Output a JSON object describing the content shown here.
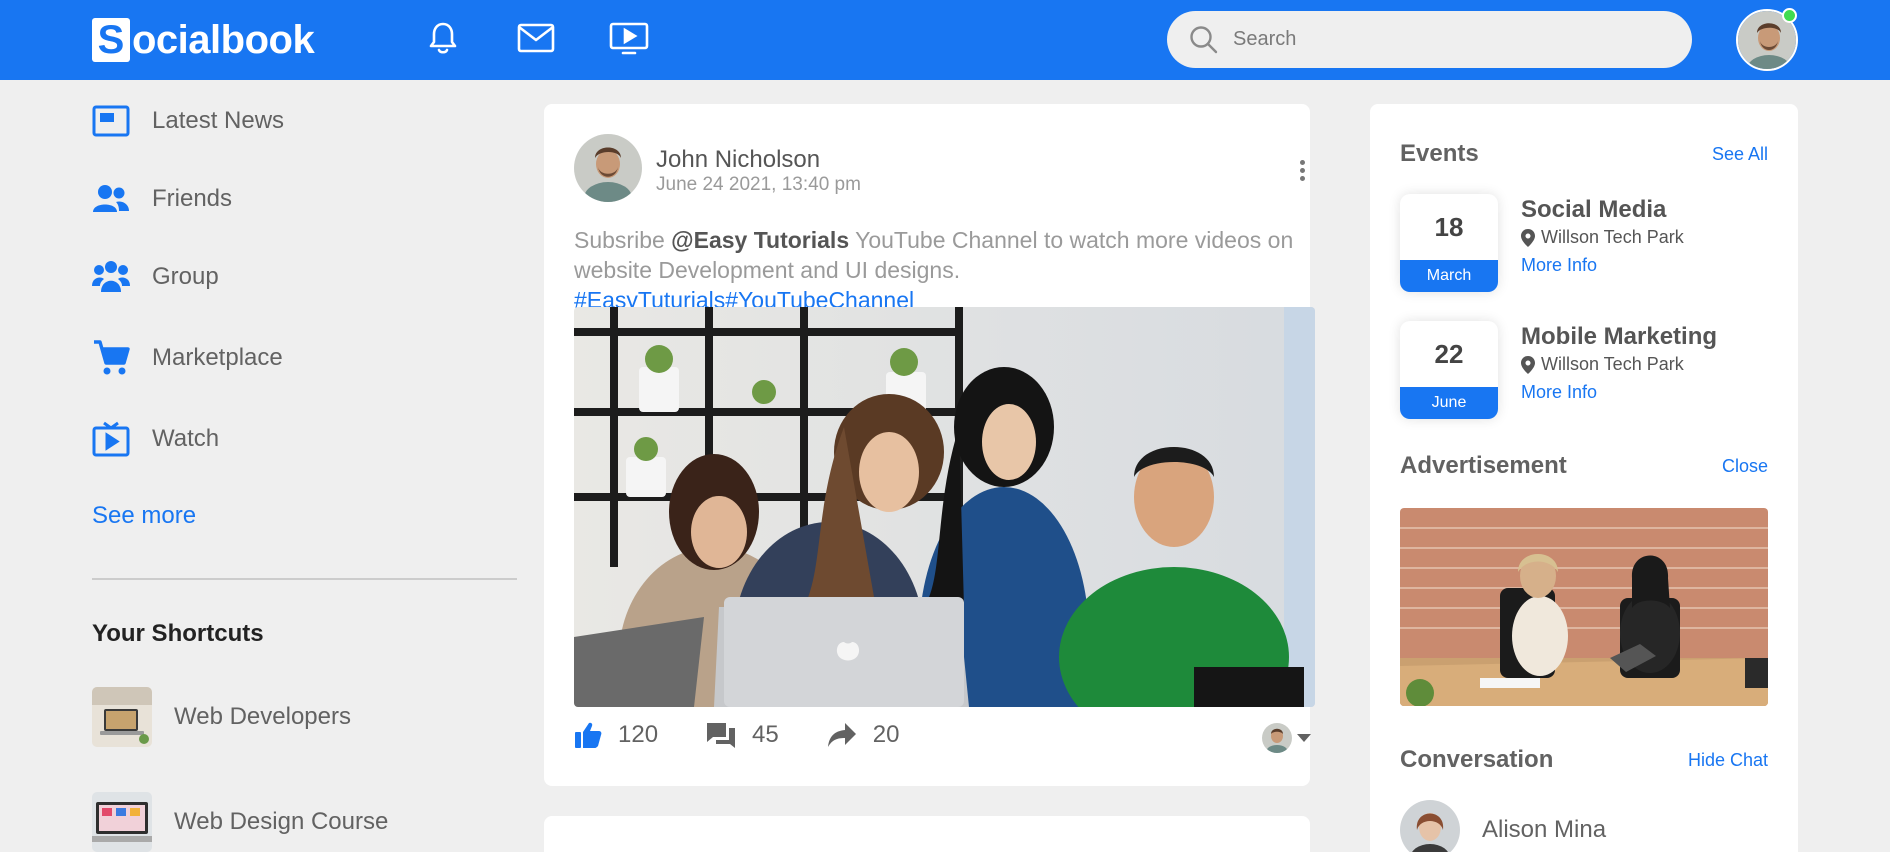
{
  "navbar": {
    "logo_letter": "S",
    "logo_text": "ocialbook",
    "search_placeholder": "Search",
    "icons": [
      "bell-icon",
      "mail-icon",
      "video-icon",
      "search-icon"
    ],
    "accent_color": "#1876f2",
    "online_color": "#41db51"
  },
  "sidebar": {
    "items": [
      {
        "label": "Latest News",
        "icon": "news-icon"
      },
      {
        "label": "Friends",
        "icon": "friends-icon"
      },
      {
        "label": "Group",
        "icon": "group-icon"
      },
      {
        "label": "Marketplace",
        "icon": "cart-icon"
      },
      {
        "label": "Watch",
        "icon": "watch-icon"
      }
    ],
    "see_more": "See more",
    "shortcuts_title": "Your Shortcuts",
    "shortcuts": [
      {
        "label": "Web Developers"
      },
      {
        "label": "Web Design Course"
      }
    ]
  },
  "post": {
    "author": "John Nicholson",
    "date": "June 24 2021, 13:40 pm",
    "text_before": "Subsribe ",
    "mention": "@Easy Tutorials",
    "text_after": " YouTube Channel to watch more videos on website Development and UI designs. ",
    "tags": "#EasyTuturials#YouTubeChannel",
    "likes": "120",
    "comments": "45",
    "shares": "20"
  },
  "right_sidebar": {
    "events_title": "Events",
    "events_link": "See All",
    "events": [
      {
        "day": "18",
        "month": "March",
        "title": "Social Media",
        "location": "Willson Tech Park",
        "more": "More Info"
      },
      {
        "day": "22",
        "month": "June",
        "title": "Mobile Marketing",
        "location": "Willson Tech Park",
        "more": "More Info"
      }
    ],
    "ad_title": "Advertisement",
    "ad_link": "Close",
    "conversation_title": "Conversation",
    "conversation_link": "Hide Chat",
    "contacts": [
      {
        "name": "Alison Mina"
      }
    ]
  }
}
